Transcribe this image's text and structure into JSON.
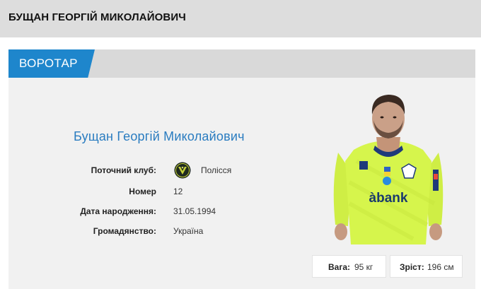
{
  "header": {
    "title": "БУЩАН ГЕОРГІЙ МИКОЛАЙОВИЧ"
  },
  "position": {
    "label": "ВОРОТАР"
  },
  "player": {
    "full_name": "Бущан Георгій Миколайович",
    "details": [
      {
        "label": "Поточний клуб:",
        "value": "Полісся"
      },
      {
        "label": "Номер",
        "value": "12"
      },
      {
        "label": "Дата народження:",
        "value": "31.05.1994"
      },
      {
        "label": "Громадянство:",
        "value": "Україна"
      }
    ],
    "club_logo_icon": "polissia-club-logo-icon",
    "photo": {
      "sponsor_text": "àbank"
    }
  },
  "stats": {
    "weight": {
      "label": "Вага:",
      "value": "95 кг"
    },
    "height": {
      "label": "Зріст:",
      "value": "196 см"
    }
  },
  "colors": {
    "accent": "#1e86cc",
    "name": "#2a7cc0",
    "jersey": "#d6f54c"
  }
}
